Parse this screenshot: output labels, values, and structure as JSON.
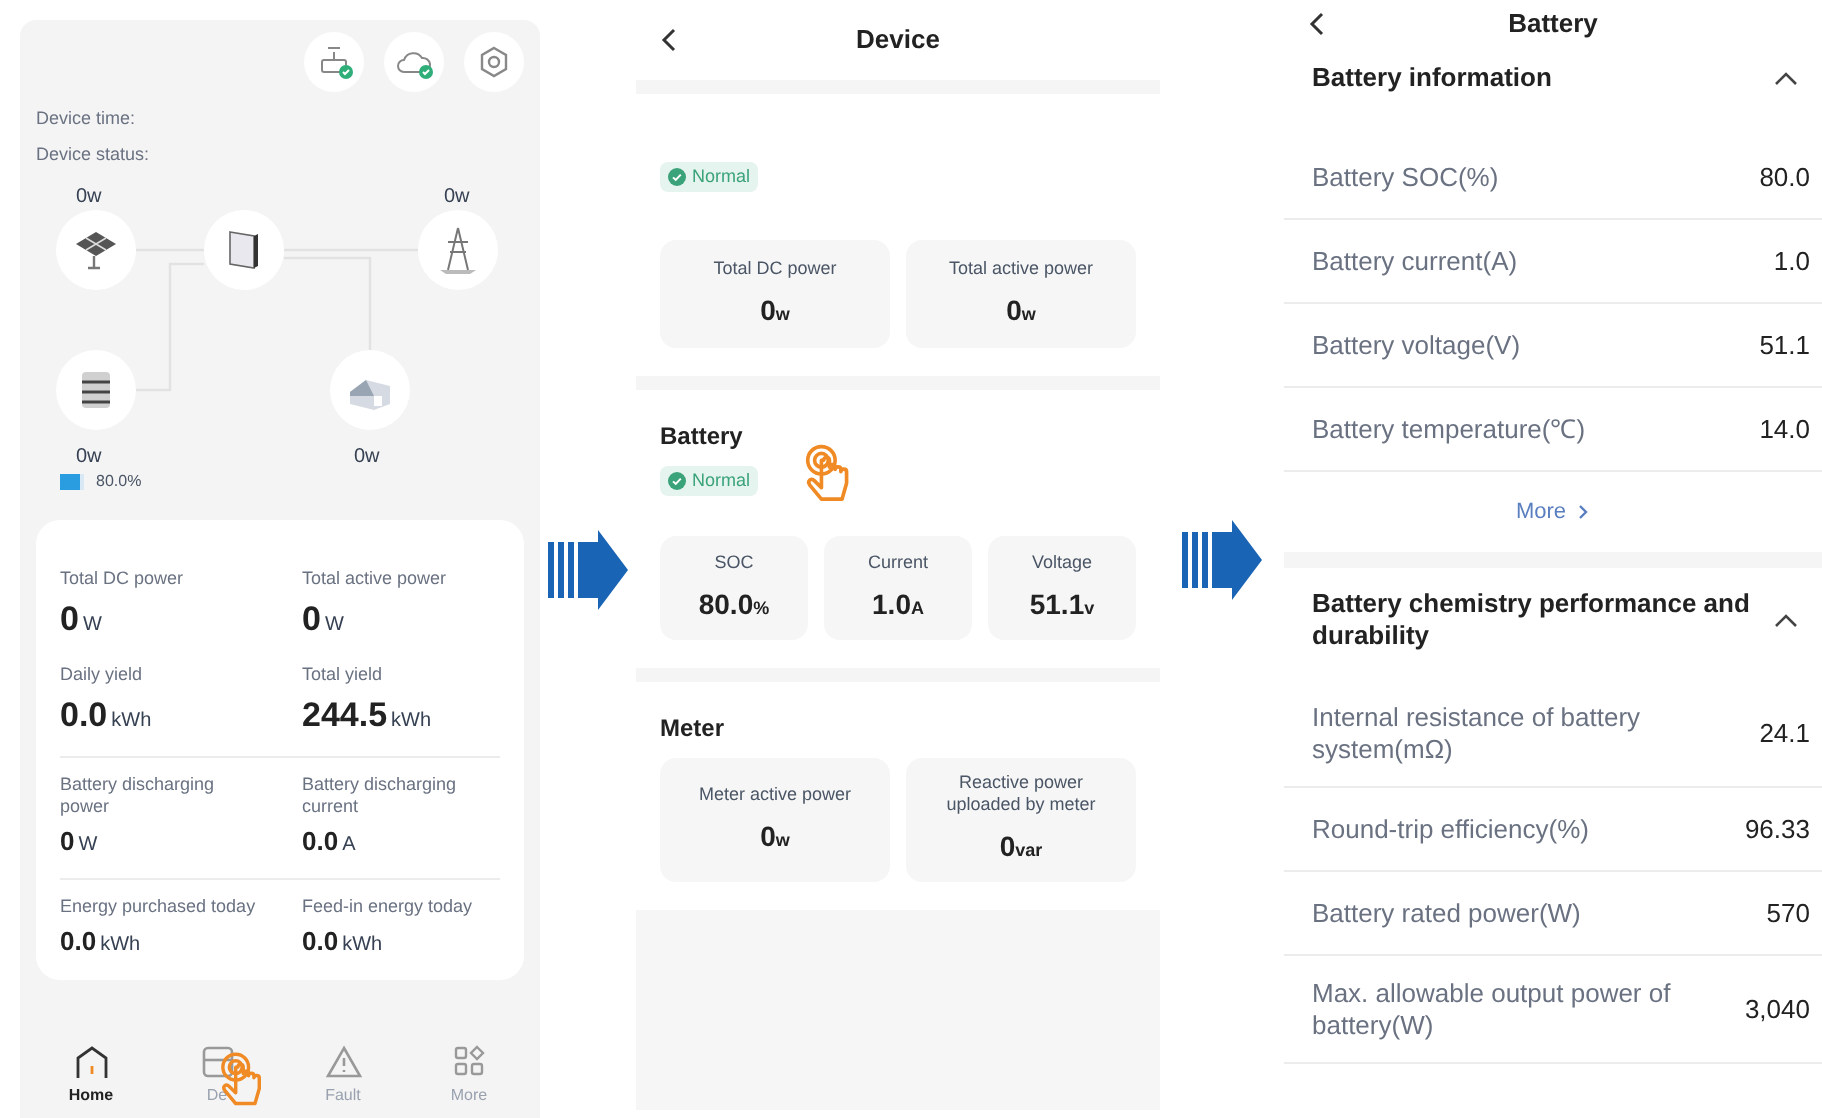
{
  "home": {
    "device_time_label": "Device time:",
    "device_status_label": "Device status:",
    "flow": {
      "pv": {
        "value": "0",
        "unit": "w"
      },
      "grid": {
        "value": "0",
        "unit": "w"
      },
      "battery": {
        "value": "0",
        "unit": "w"
      },
      "load": {
        "value": "0",
        "unit": "w"
      },
      "battery_soc": "80.0%",
      "level": 0.8
    },
    "stat_groups": [
      [
        {
          "label": "Total DC power",
          "value": "0",
          "unit": "W"
        },
        {
          "label": "Total active power",
          "value": "0",
          "unit": "W"
        },
        {
          "label": "Daily yield",
          "value": "0.0",
          "unit": "kWh"
        },
        {
          "label": "Total yield",
          "value": "244.5",
          "unit": "kWh"
        }
      ],
      [
        {
          "label": "Battery discharging power",
          "value": "0",
          "unit": "W"
        },
        {
          "label": "Battery discharging current",
          "value": "0.0",
          "unit": "A"
        }
      ],
      [
        {
          "label": "Energy purchased today",
          "value": "0.0",
          "unit": "kWh"
        },
        {
          "label": "Feed-in energy today",
          "value": "0.0",
          "unit": "kWh"
        }
      ]
    ],
    "nav": [
      {
        "kind": "home",
        "label": "Home",
        "selected": true
      },
      {
        "kind": "device",
        "label": "De",
        "selected": false
      },
      {
        "kind": "fault",
        "label": "Fault",
        "selected": false
      },
      {
        "kind": "more",
        "label": "More",
        "selected": false
      }
    ]
  },
  "device": {
    "title": "Device",
    "sections": [
      {
        "status": "Normal",
        "cards": [
          {
            "label": "Total DC power",
            "value": "0",
            "unit": "w"
          },
          {
            "label": "Total active power",
            "value": "0",
            "unit": "w"
          }
        ]
      },
      {
        "title": "Battery",
        "status": "Normal",
        "tap": true,
        "cards": [
          {
            "label": "SOC",
            "value": "80.0",
            "unit": "%"
          },
          {
            "label": "Current",
            "value": "1.0",
            "unit": "A"
          },
          {
            "label": "Voltage",
            "value": "51.1",
            "unit": "v"
          }
        ]
      },
      {
        "title": "Meter",
        "cards": [
          {
            "label": "Meter active power",
            "value": "0",
            "unit": "w"
          },
          {
            "label": "Reactive power uploaded by meter",
            "value": "0",
            "unit": "var"
          }
        ]
      }
    ]
  },
  "battery": {
    "title": "Battery",
    "sections": [
      {
        "title": "Battery information",
        "expanded": true,
        "more": "More",
        "rows": [
          {
            "label": "Battery SOC(%)",
            "value": "80.0"
          },
          {
            "label": "Battery current(A)",
            "value": "1.0"
          },
          {
            "label": "Battery voltage(V)",
            "value": "51.1"
          },
          {
            "label": "Battery temperature(℃)",
            "value": "14.0"
          }
        ]
      },
      {
        "title": "Battery chemistry performance and durability",
        "expanded": true,
        "rows": [
          {
            "label": "Internal resistance of battery system(mΩ)",
            "value": "24.1"
          },
          {
            "label": "Round-trip efficiency(%)",
            "value": "96.33"
          },
          {
            "label": "Battery rated power(W)",
            "value": "570"
          },
          {
            "label": "Max. allowable output power of battery(W)",
            "value": "3,040"
          }
        ]
      }
    ]
  }
}
